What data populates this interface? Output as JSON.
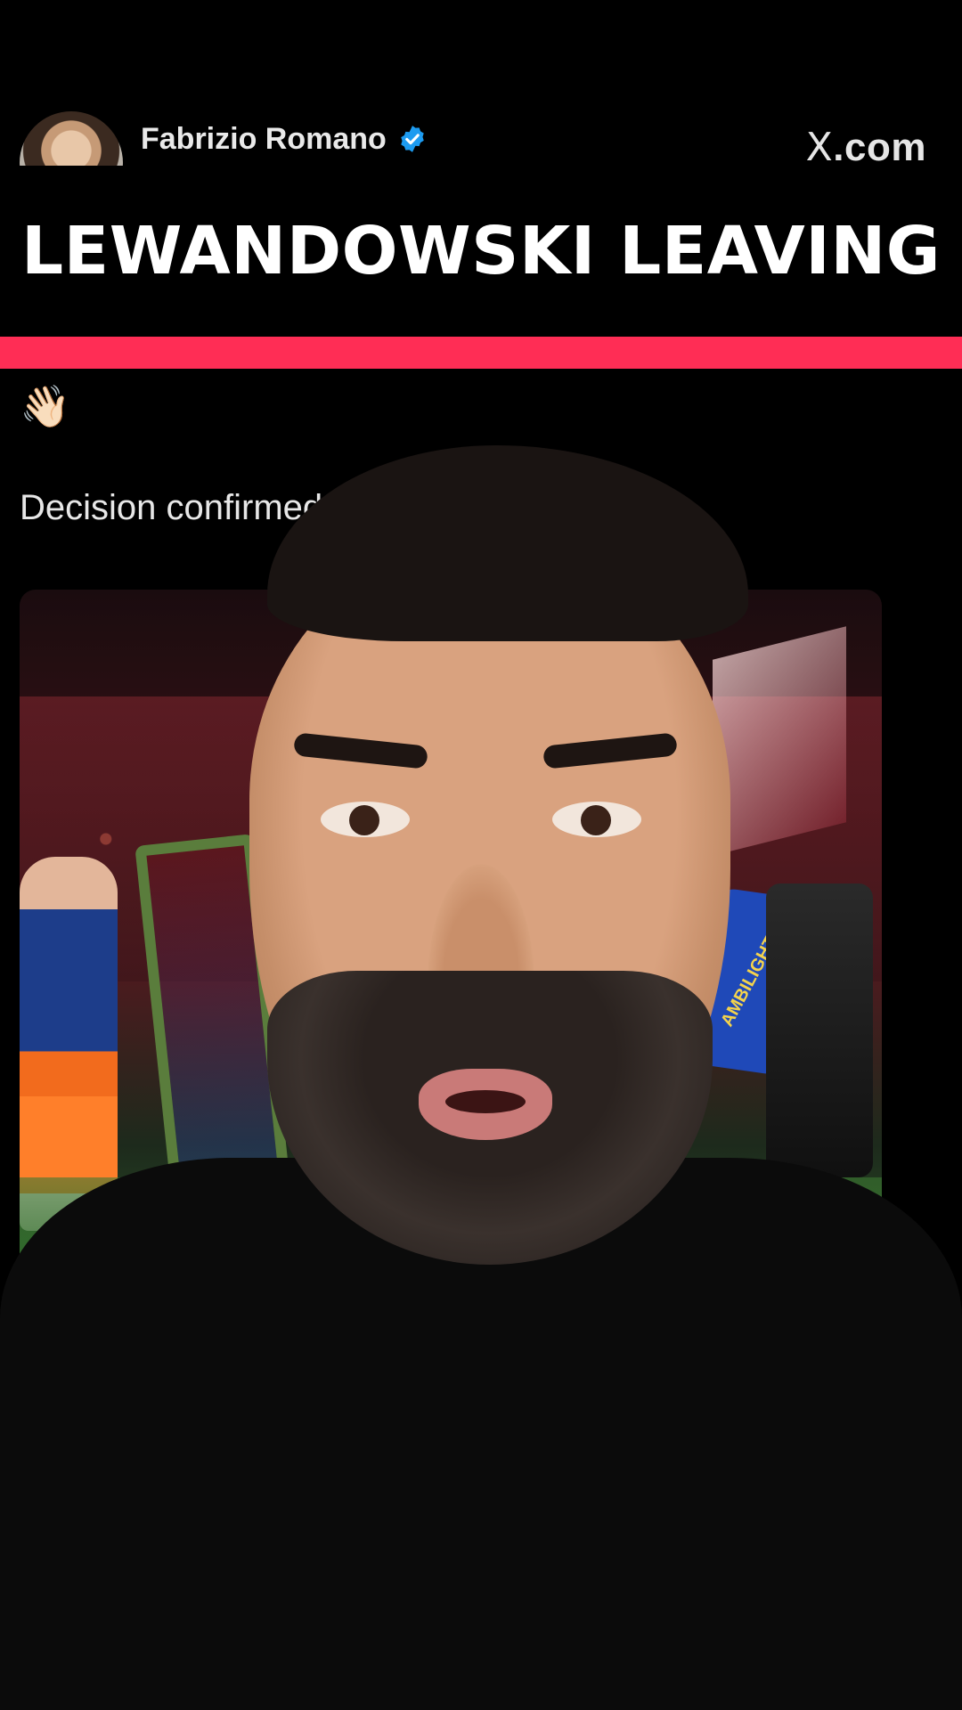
{
  "tweet": {
    "author_name": "Fabrizio Romano",
    "verified": true,
    "source": ".com",
    "source_logo": "X",
    "wave_emoji": "👋🏻",
    "text": "Decision confirmed.",
    "photo": {
      "sleeve_text": "AMBILIGHT"
    }
  },
  "overlay": {
    "headline": "LEWANDOWSKI LEAVING",
    "accent_color": "#ff2d55"
  },
  "colors": {
    "background": "#000000",
    "verified_badge": "#1d9bf0"
  },
  "icons": {
    "verified": "verified-badge-icon",
    "x_logo": "x-logo-icon",
    "check": "check-mark-icon"
  }
}
